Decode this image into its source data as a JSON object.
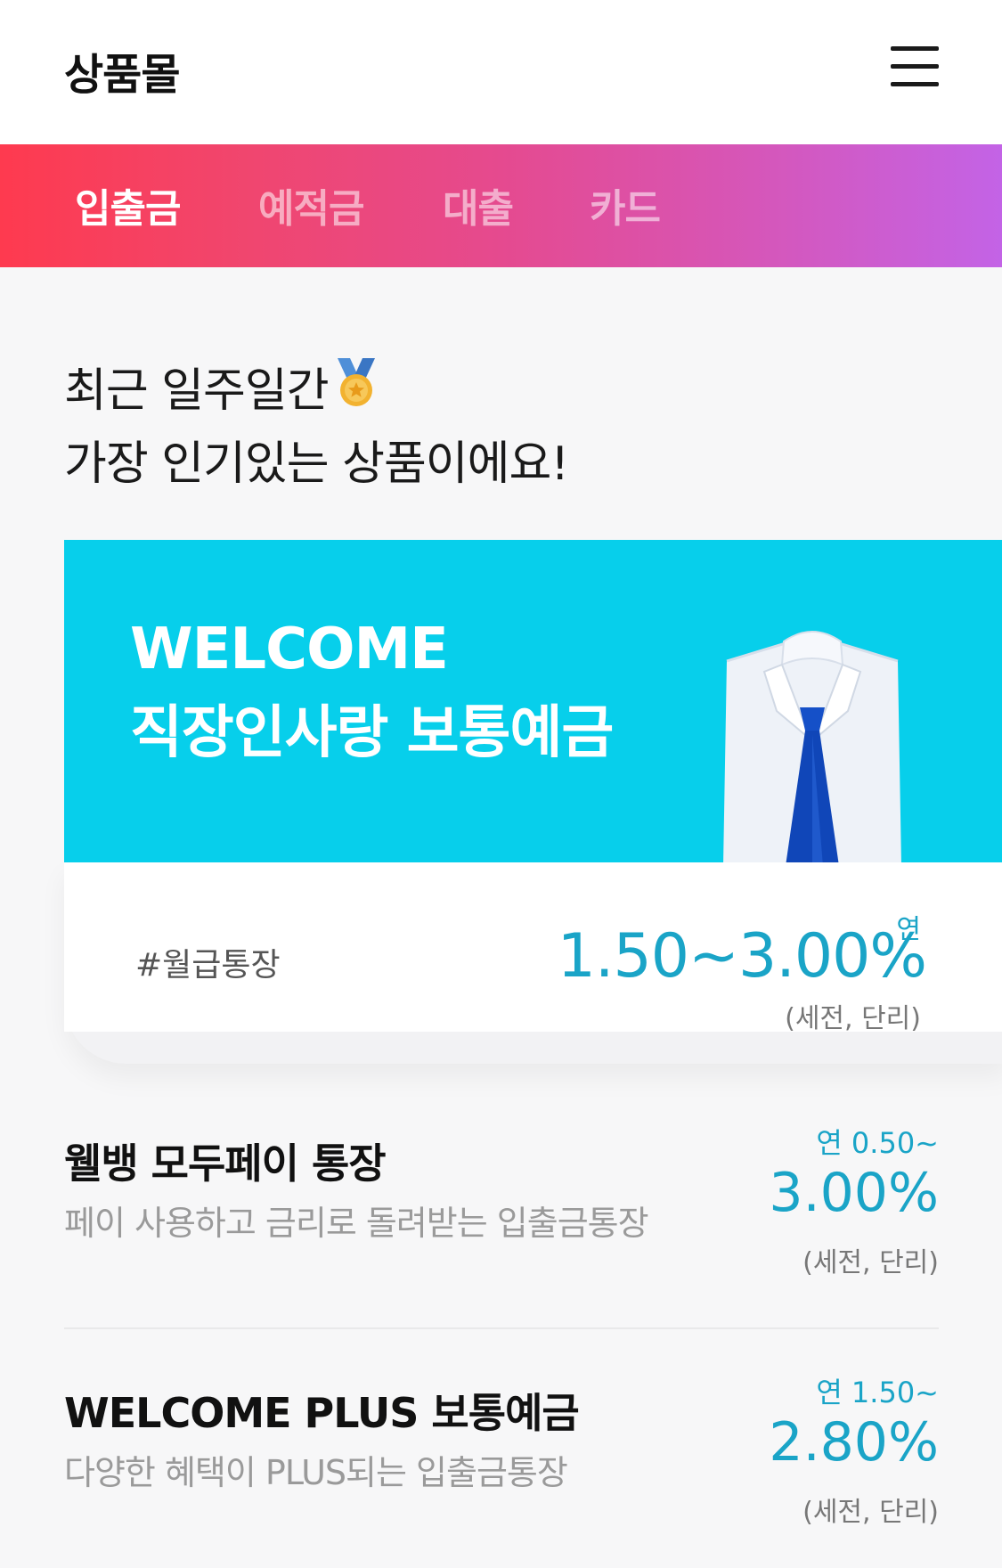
{
  "header": {
    "title": "상품몰",
    "menu_icon": "hamburger-menu-icon"
  },
  "tabs": [
    {
      "label": "입출금",
      "active": true
    },
    {
      "label": "예적금",
      "active": false
    },
    {
      "label": "대출",
      "active": false
    },
    {
      "label": "카드",
      "active": false
    }
  ],
  "intro": {
    "line1": "최근 일주일간",
    "line2": "가장 인기있는 상품이에요!",
    "icon": "medal-icon"
  },
  "featured": {
    "title_line1": "WELCOME",
    "title_line2": "직장인사랑 보통예금",
    "hashtag": "#월급통장",
    "rate_prefix": "연",
    "rate": "1.50~3.00%",
    "rate_note": "(세전, 단리)",
    "banner_color": "#07cfeb",
    "image": "shirt-and-tie"
  },
  "products": [
    {
      "name": "웰뱅 모두페이 통장",
      "description": "페이 사용하고 금리로 돌려받는 입출금통장",
      "rate_prefix": "연 0.50~",
      "rate": "3.00%",
      "rate_note": "(세전, 단리)"
    },
    {
      "name": "WELCOME PLUS 보통예금",
      "description": "다양한 혜택이 PLUS되는 입출금통장",
      "rate_prefix": "연 1.50~",
      "rate": "2.80%",
      "rate_note": "(세전, 단리)"
    }
  ],
  "colors": {
    "accent": "#1aa4c7",
    "gradient_start": "#fe3a4f",
    "gradient_end": "#c363e6"
  }
}
